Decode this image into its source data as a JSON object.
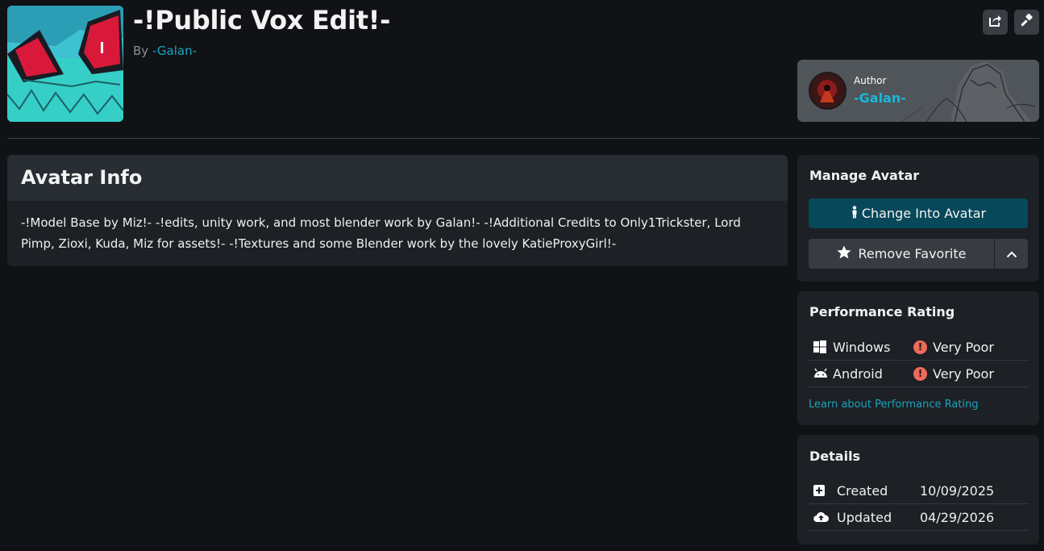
{
  "avatar": {
    "title": "-!Public Vox Edit!-",
    "by_prefix": "By",
    "author_name": "-Galan-"
  },
  "author_card": {
    "caption": "Author",
    "name": "-Galan-"
  },
  "info": {
    "heading": "Avatar Info",
    "description": "-!Model Base by Miz!- -!edits, unity work, and most blender work by Galan!- -!Additional Credits to Only1Trickster, Lord Pimp, Zioxi, Kuda, Miz for assets!- -!Textures and some Blender work by the lovely KatieProxyGirl!-"
  },
  "manage": {
    "heading": "Manage Avatar",
    "change_label": "Change Into Avatar",
    "favorite_label": "Remove Favorite"
  },
  "performance": {
    "heading": "Performance Rating",
    "rows": [
      {
        "platform": "Windows",
        "rating": "Very Poor",
        "icon": "windows-icon"
      },
      {
        "platform": "Android",
        "rating": "Very Poor",
        "icon": "android-icon"
      }
    ],
    "learn_link": "Learn about Performance Rating"
  },
  "details": {
    "heading": "Details",
    "rows": [
      {
        "label": "Created",
        "value": "10/09/2025",
        "icon": "plus-square-icon"
      },
      {
        "label": "Updated",
        "value": "04/29/2026",
        "icon": "cloud-upload-icon"
      }
    ]
  },
  "colors": {
    "background": "#101216",
    "panel": "#1d2025",
    "accent": "#1ca3bd",
    "primary_button": "#07485a",
    "warning": "#ee6b5a"
  }
}
